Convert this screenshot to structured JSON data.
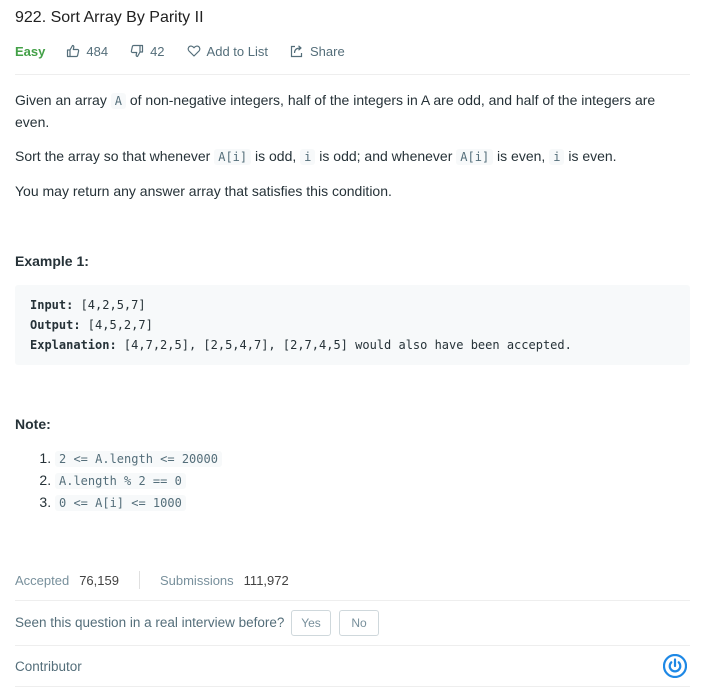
{
  "problem": {
    "title": "922. Sort Array By Parity II",
    "difficulty": "Easy",
    "likes": "484",
    "dislikes": "42",
    "add_to_list": "Add to List",
    "share": "Share"
  },
  "description": {
    "p1_a": "Given an array ",
    "p1_code": "A",
    "p1_b": " of non-negative integers, half of the integers in A are odd, and half of the integers are even.",
    "p2_a": "Sort the array so that whenever ",
    "p2_code1": "A[i]",
    "p2_b": " is odd, ",
    "p2_code2": "i",
    "p2_c": " is odd; and whenever ",
    "p2_code3": "A[i]",
    "p2_d": " is even, ",
    "p2_code4": "i",
    "p2_e": " is even.",
    "p3": "You may return any answer array that satisfies this condition."
  },
  "example": {
    "heading": "Example 1:",
    "input_label": "Input:",
    "input_value": " [4,2,5,7]",
    "output_label": "Output:",
    "output_value": " [4,5,2,7]",
    "explanation_label": "Explanation:",
    "explanation_value": " [4,7,2,5], [2,5,4,7], [2,7,4,5] would also have been accepted."
  },
  "note": {
    "heading": "Note:",
    "items": [
      "2 <= A.length <= 20000",
      "A.length % 2 == 0",
      "0 <= A[i] <= 1000"
    ]
  },
  "stats": {
    "accepted_label": "Accepted",
    "accepted_value": "76,159",
    "submissions_label": "Submissions",
    "submissions_value": "111,972"
  },
  "interview": {
    "question": "Seen this question in a real interview before?",
    "yes": "Yes",
    "no": "No"
  },
  "contributor_label": "Contributor",
  "icons": [
    "thumbs-up-icon",
    "thumbs-down-icon",
    "heart-icon",
    "share-icon",
    "power-icon"
  ],
  "colors": {
    "easy": "#43a047",
    "accent": "#1e88e5"
  }
}
